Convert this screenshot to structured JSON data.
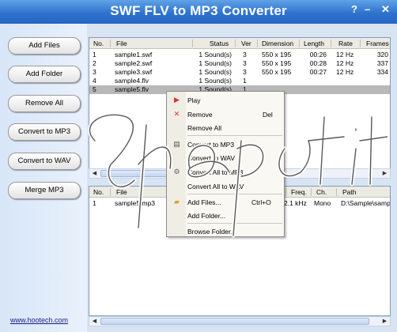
{
  "app": {
    "title": "SWF FLV to MP3 Converter",
    "help_glyph": "?",
    "min_glyph": "–",
    "close_glyph": "✕"
  },
  "sidebar": {
    "buttons": [
      "Add Files",
      "Add Folder",
      "Remove All",
      "Convert to MP3",
      "Convert to WAV",
      "Merge MP3"
    ],
    "website": "www.hootech.com"
  },
  "top_list": {
    "columns": [
      "No.",
      "File",
      "Status",
      "Ver",
      "Dimension",
      "Length",
      "Rate",
      "Frames"
    ],
    "rows": [
      [
        "1",
        "sample1.swf",
        "1 Sound(s)",
        "3",
        "550 x 195",
        "00:26",
        "12 Hz",
        "320"
      ],
      [
        "2",
        "sample2.swf",
        "1 Sound(s)",
        "3",
        "550 x 195",
        "00:28",
        "12 Hz",
        "337"
      ],
      [
        "3",
        "sample3.swf",
        "1 Sound(s)",
        "3",
        "550 x 195",
        "00:27",
        "12 Hz",
        "334"
      ],
      [
        "4",
        "sample4.flv",
        "1 Sound(s)",
        "1",
        "",
        "",
        "",
        ""
      ],
      [
        "5",
        "sample5.flv",
        "1 Sound(s)",
        "1",
        "",
        "",
        "",
        ""
      ]
    ],
    "selected_row": 4
  },
  "bottom_list": {
    "columns": [
      "No.",
      "File",
      "Freq.",
      "Ch.",
      "Path"
    ],
    "rows": [
      [
        "1",
        "sample5.mp3",
        "2.1 kHz",
        "Mono",
        "D:\\Sample\\samp"
      ]
    ]
  },
  "context_menu": {
    "items": [
      {
        "label": "Play",
        "shortcut": "",
        "icon": "play-icon"
      },
      {
        "label": "Remove",
        "shortcut": "Del",
        "icon": "remove-x-icon"
      },
      {
        "label": "Remove All",
        "shortcut": "",
        "icon": ""
      },
      {
        "label": "Convert to MP3",
        "shortcut": "",
        "icon": "doc-icon"
      },
      {
        "label": "Convert to WAV",
        "shortcut": "",
        "icon": ""
      },
      {
        "label": "Convert All to MP3",
        "shortcut": "",
        "icon": "gear-icon"
      },
      {
        "label": "Convert All to WAV",
        "shortcut": "",
        "icon": ""
      },
      {
        "label": "Add Files...",
        "shortcut": "Ctrl+O",
        "icon": "folder-icon"
      },
      {
        "label": "Add Folder...",
        "shortcut": "",
        "icon": ""
      },
      {
        "label": "Browse Folder...",
        "shortcut": "",
        "icon": ""
      }
    ]
  },
  "colors": {
    "title_blue": "#2f73cf",
    "selection_gray": "#b8b8b8",
    "play_red": "#d83030"
  }
}
